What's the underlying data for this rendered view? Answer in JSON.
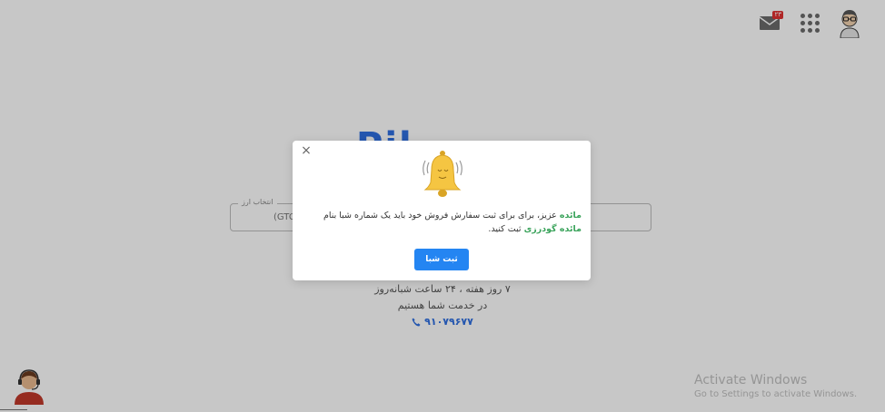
{
  "topbar": {
    "mail_badge": "۲۳"
  },
  "logo_text": "Pil",
  "currency_field": {
    "legend": "انتخاب ارز",
    "value": "(GTC"
  },
  "service": {
    "line1": "۷ روز هفته ، ۲۴ ساعت شبانه‌روز",
    "line2": "در خدمت شما هستیم",
    "phone": "۹۱۰۷۹۶۷۷"
  },
  "watermark": {
    "title": "Activate Windows",
    "subtitle": "Go to Settings to activate Windows."
  },
  "modal": {
    "close_glyph": "×",
    "name_highlight": "مائده",
    "text_part1": " عزیز، برای برای ثبت سفارش فروش خود باید یک شماره شبا بنام ",
    "fullname_highlight": "مائده گودرزی",
    "text_part2": " ثبت کنید.",
    "button_label": "ثبت شبا"
  },
  "colors": {
    "accent": "#2485f2",
    "highlight": "#3aa35b",
    "bell": "#f5c542"
  }
}
